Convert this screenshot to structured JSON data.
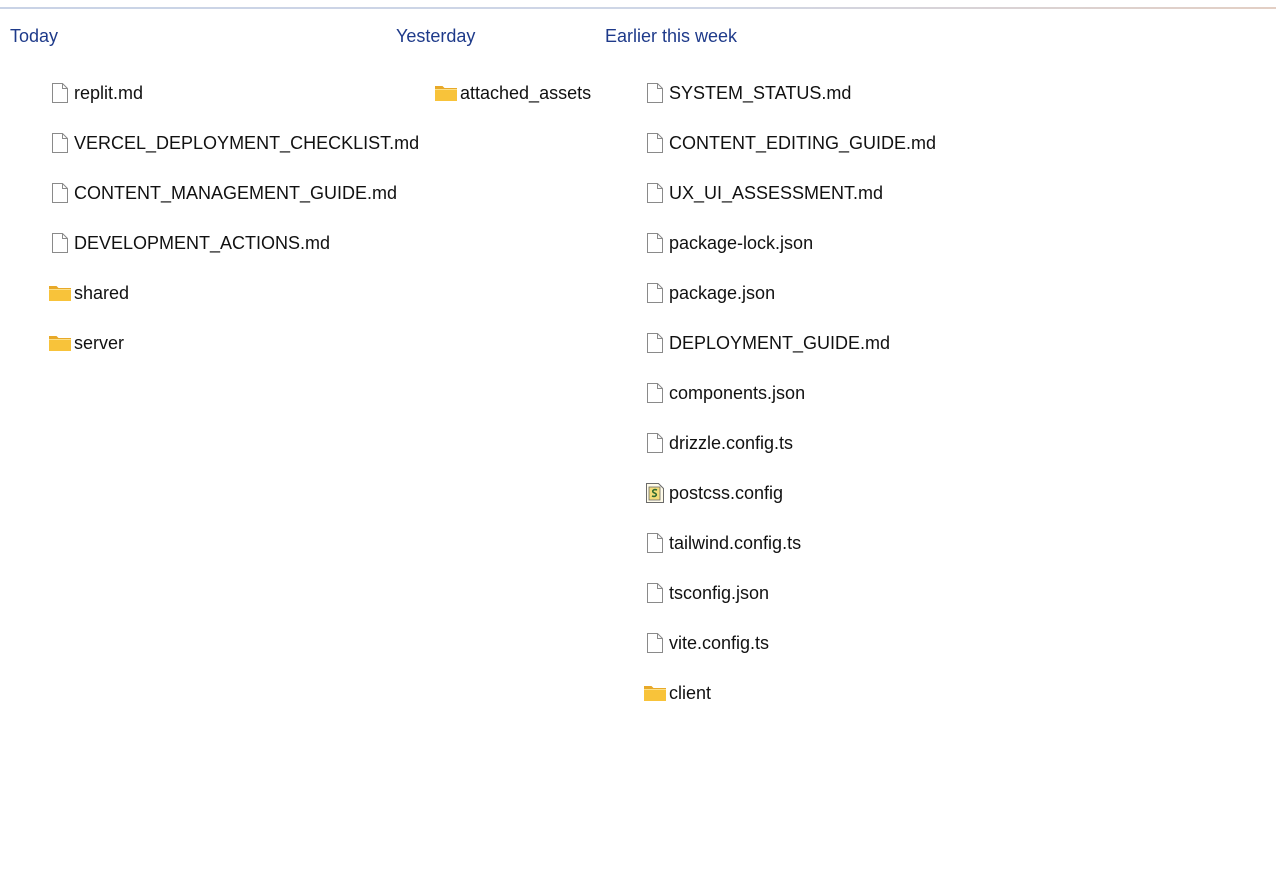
{
  "colors": {
    "header_text": "#1e3a8a",
    "item_text": "#111111",
    "folder_fill": "#f8c33a",
    "file_fill": "#ffffff",
    "file_stroke": "#8a8a8a"
  },
  "groups": [
    {
      "id": "today",
      "header": "Today",
      "items": [
        {
          "name": "replit.md",
          "icon": "document-icon"
        },
        {
          "name": "VERCEL_DEPLOYMENT_CHECKLIST.md",
          "icon": "document-icon"
        },
        {
          "name": "CONTENT_MANAGEMENT_GUIDE.md",
          "icon": "document-icon"
        },
        {
          "name": "DEVELOPMENT_ACTIONS.md",
          "icon": "document-icon"
        },
        {
          "name": "shared",
          "icon": "folder-icon"
        },
        {
          "name": "server",
          "icon": "folder-icon"
        }
      ]
    },
    {
      "id": "yesterday",
      "header": "Yesterday",
      "items": [
        {
          "name": "attached_assets",
          "icon": "folder-icon"
        }
      ]
    },
    {
      "id": "earlier",
      "header": "Earlier this week",
      "items": [
        {
          "name": "SYSTEM_STATUS.md",
          "icon": "document-icon"
        },
        {
          "name": "CONTENT_EDITING_GUIDE.md",
          "icon": "document-icon"
        },
        {
          "name": "UX_UI_ASSESSMENT.md",
          "icon": "document-icon"
        },
        {
          "name": "package-lock.json",
          "icon": "document-icon"
        },
        {
          "name": "package.json",
          "icon": "document-icon"
        },
        {
          "name": "DEPLOYMENT_GUIDE.md",
          "icon": "document-icon"
        },
        {
          "name": "components.json",
          "icon": "document-icon"
        },
        {
          "name": "drizzle.config.ts",
          "icon": "document-icon"
        },
        {
          "name": "postcss.config",
          "icon": "script-file-icon"
        },
        {
          "name": "tailwind.config.ts",
          "icon": "document-icon"
        },
        {
          "name": "tsconfig.json",
          "icon": "document-icon"
        },
        {
          "name": "vite.config.ts",
          "icon": "document-icon"
        },
        {
          "name": "client",
          "icon": "folder-icon"
        }
      ]
    }
  ]
}
